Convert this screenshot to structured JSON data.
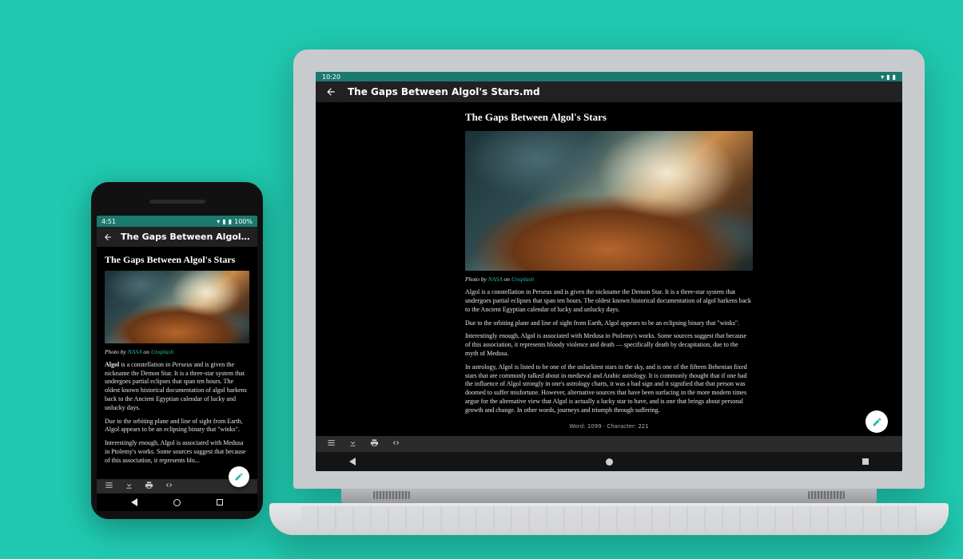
{
  "phone": {
    "status": {
      "time": "4:51",
      "battery": "100%"
    },
    "appbar": {
      "title": "The Gaps Between Algol's Sta..."
    },
    "article": {
      "heading": "The Gaps Between Algol's Stars",
      "caption_prefix": "Photo by ",
      "caption_author": "NASA",
      "caption_on": " on ",
      "caption_source": "Unsplash",
      "p1a": "Algol",
      "p1b": " is a constellation in ",
      "p1c": "Perseus",
      "p1d": " and is given the nickname the Demon Star. It is a three-star system that undergoes partial eclipses that span ten hours. The oldest known historical documentation of algol harkens back to the Ancient Egyptian calendar of lucky and unlucky days.",
      "p2": "Due to the orbiting plane and line of sight from Earth, Algol appears to be an eclipsing binary that \"winks\".",
      "p3": "Interestingly enough, Algol is associated with Medusa in Ptolemy's works. Some sources suggest that because of this association, it represents blo..."
    }
  },
  "laptop": {
    "status": {
      "time": "10:20"
    },
    "appbar": {
      "title": "The Gaps Between Algol's Stars.md"
    },
    "article": {
      "heading": "The Gaps Between Algol's Stars",
      "caption_prefix": "Photo by ",
      "caption_author": "NASA",
      "caption_on": " on ",
      "caption_source": "Unsplash",
      "p1": "Algol is a constellation in Perseus and is given the nickname the Demon Star. It is a three-star system that undergoes partial eclipses that span ten hours. The oldest known historical documentation of algol harkens back to the Ancient Egyptian calendar of lucky and unlucky days.",
      "p2": "Due to the orbiting plane and line of sight from Earth, Algol appears to be an eclipsing binary that \"winks\".",
      "p3": "Interestingly enough, Algol is associated with Medusa in Ptolemy's works. Some sources suggest that because of this association, it represents bloody violence and death — specifically death by decapitation, due to the myth of Medusa.",
      "p4": "In astrology, Algol is listed to be one of the unluckiest stars in the sky, and is one of the fifteen Behenian fixed stars that are commonly talked about in medieval and Arabic astrology. It is commonly thought that if one had the influence of Algol strongly in one's astrology charts, it was a bad sign and it signified that that person was doomed to suffer misfortune. However, alternative sources that have been surfacing in the more modern times argue for the alternative view that Algol is actually a lucky star to have, and is one that brings about personal growth and change. In other words, journeys and triumph through suffering."
    },
    "counter": "Word: 1099 · Character: 221"
  },
  "colors": {
    "accent": "#1fbba6"
  }
}
